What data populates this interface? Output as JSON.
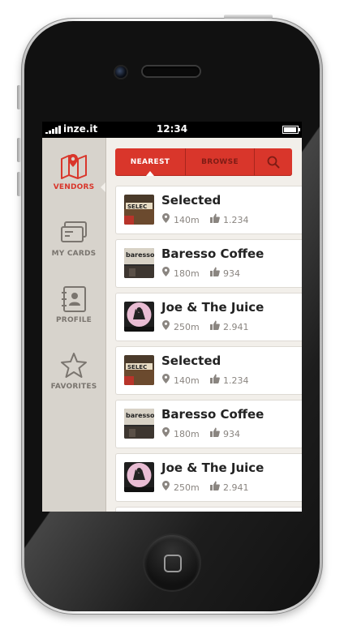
{
  "status_bar": {
    "carrier": "inze.it",
    "time": "12:34"
  },
  "sidebar": {
    "items": [
      {
        "label": "VENDORS",
        "icon": "map-icon",
        "active": true
      },
      {
        "label": "MY CARDS",
        "icon": "cards-icon",
        "active": false
      },
      {
        "label": "PROFILE",
        "icon": "contact-book-icon",
        "active": false
      },
      {
        "label": "FAVORITES",
        "icon": "star-icon",
        "active": false
      }
    ]
  },
  "tabs": {
    "nearest": "NEAREST",
    "browse": "BROWSE",
    "search_icon": "search-icon"
  },
  "vendors": [
    {
      "name": "Selected",
      "distance": "140m",
      "likes": "1.234"
    },
    {
      "name": "Baresso Coffee",
      "distance": "180m",
      "likes": "934"
    },
    {
      "name": "Joe & The Juice",
      "distance": "250m",
      "likes": "2.941"
    },
    {
      "name": "Selected",
      "distance": "140m",
      "likes": "1.234"
    },
    {
      "name": "Baresso Coffee",
      "distance": "180m",
      "likes": "934"
    },
    {
      "name": "Joe & The Juice",
      "distance": "250m",
      "likes": "2.941"
    }
  ],
  "colors": {
    "accent": "#d9362b",
    "sidebar": "#d7d3cc",
    "background": "#f2efea"
  }
}
